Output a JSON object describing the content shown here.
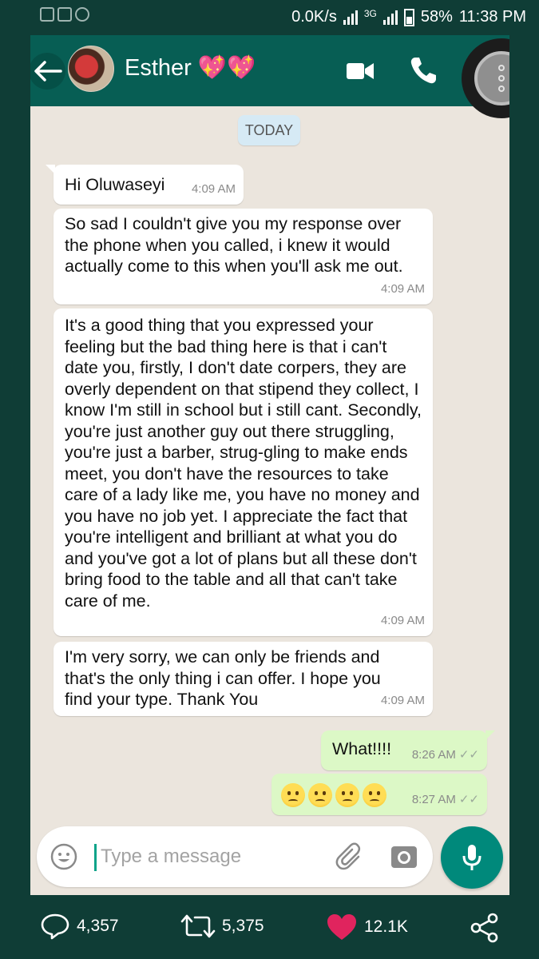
{
  "status_bar": {
    "speed": "0.0K/s",
    "network": "3G",
    "battery": "58%",
    "time": "11:38 PM"
  },
  "header": {
    "contact_name": "Esther 💖💖",
    "icons": [
      "back-arrow-icon",
      "video-icon",
      "phone-icon",
      "more-options-icon"
    ]
  },
  "date_chip": "TODAY",
  "messages": [
    {
      "from": "contact",
      "text": "Hi Oluwaseyi",
      "time": "4:09 AM"
    },
    {
      "from": "contact",
      "text": "So sad I couldn't give you my response over the phone when you called, i knew it would actually come to this when you'll ask me out.",
      "time": "4:09 AM"
    },
    {
      "from": "contact",
      "text": "It's a good thing that you expressed your feeling but the bad thing here is that i can't date you, firstly, I don't date corpers, they are overly dependent on that stipend they collect, I know I'm still in school but i still cant. Secondly, you're just another guy out there struggling, you're just a barber, strug-gling to make ends meet, you don't have the resources to take care of a lady like me, you have no money and you have no job yet. I appreciate the fact that you're intelligent and brilliant at what you do and you've got a lot of plans but all these don't bring food to the table and all that can't take care of me.",
      "time": "4:09 AM"
    },
    {
      "from": "contact",
      "text": "I'm very sorry, we can only be friends and that's the only thing i can offer. I hope you find your type. Thank You",
      "time": "4:09 AM"
    },
    {
      "from": "me",
      "text": "What!!!!",
      "time": "8:26 AM",
      "ticks": "✓✓"
    },
    {
      "from": "me",
      "text": "😕😕😕😕",
      "time": "8:27 AM",
      "ticks": "✓✓"
    }
  ],
  "composer": {
    "placeholder": "Type a message"
  },
  "tweet_bar": {
    "replies": "4,357",
    "retweets": "5,375",
    "likes": "12.1K"
  },
  "colors": {
    "header": "#075e54",
    "outgoing_bubble": "#dcf8c6",
    "incoming_bubble": "#ffffff",
    "chat_background": "#ece5dd",
    "mic_button": "#00897b",
    "like_heart": "#e0245e"
  }
}
